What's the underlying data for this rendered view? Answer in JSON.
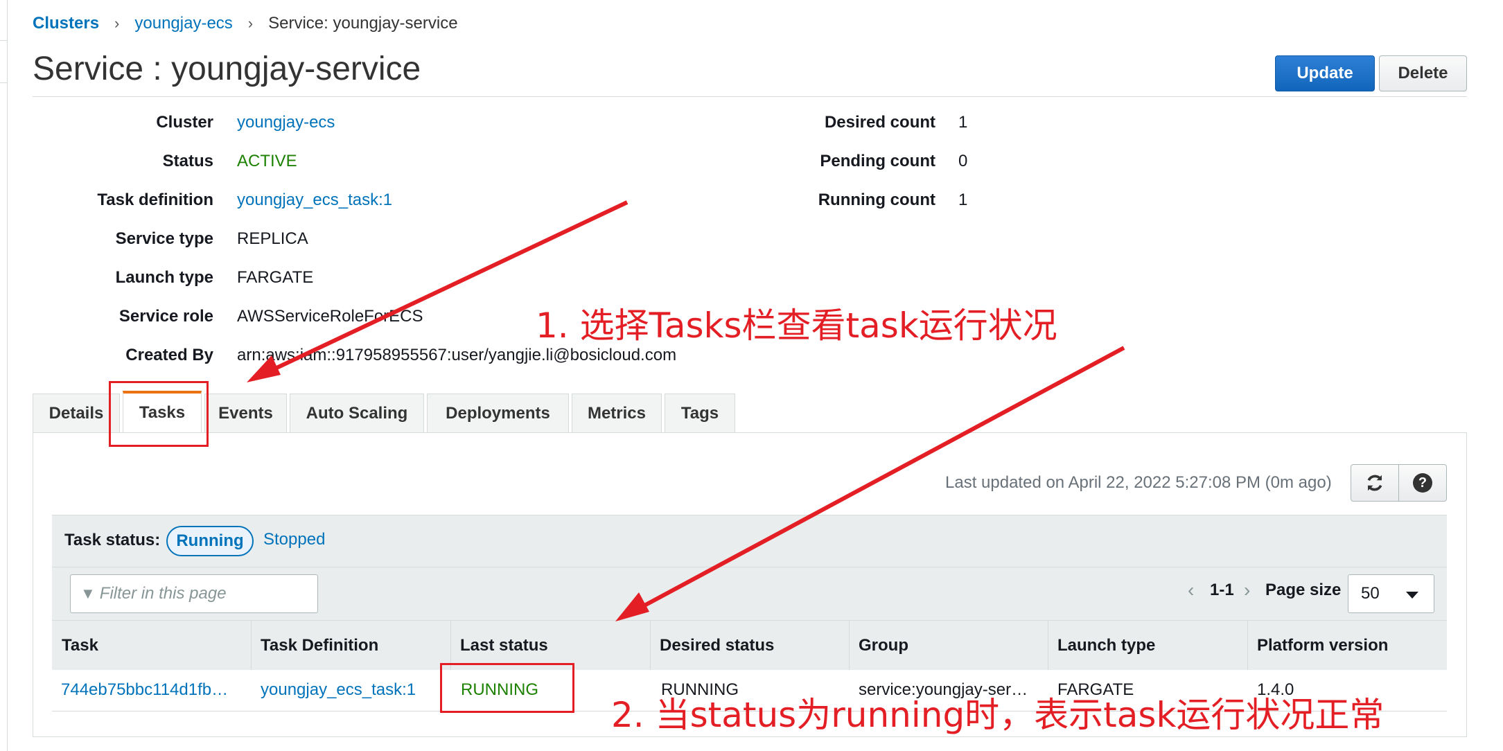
{
  "breadcrumb": {
    "clusters": "Clusters",
    "cluster": "youngjay-ecs",
    "current": "Service: youngjay-service",
    "separator": "›"
  },
  "page_title": "Service : youngjay-service",
  "actions": {
    "update": "Update",
    "delete": "Delete"
  },
  "details_left": [
    {
      "label": "Cluster",
      "value": "youngjay-ecs",
      "kind": "link"
    },
    {
      "label": "Status",
      "value": "ACTIVE",
      "kind": "active"
    },
    {
      "label": "Task definition",
      "value": "youngjay_ecs_task:1",
      "kind": "link"
    },
    {
      "label": "Service type",
      "value": "REPLICA",
      "kind": "text"
    },
    {
      "label": "Launch type",
      "value": "FARGATE",
      "kind": "text"
    },
    {
      "label": "Service role",
      "value": "AWSServiceRoleForECS",
      "kind": "text"
    },
    {
      "label": "Created By",
      "value": "arn:aws:iam::917958955567:user/yangjie.li@bosicloud.com",
      "kind": "text"
    }
  ],
  "details_right": [
    {
      "label": "Desired count",
      "value": "1"
    },
    {
      "label": "Pending count",
      "value": "0"
    },
    {
      "label": "Running count",
      "value": "1"
    }
  ],
  "tabs": [
    "Details",
    "Tasks",
    "Events",
    "Auto Scaling",
    "Deployments",
    "Metrics",
    "Tags"
  ],
  "selected_tab": "Tasks",
  "last_updated": "Last updated on April 22, 2022 5:27:08 PM (0m ago)",
  "task_status": {
    "label": "Task status:",
    "running": "Running",
    "stopped": "Stopped"
  },
  "filter": {
    "placeholder": "Filter in this page",
    "icon": "filter-icon"
  },
  "pagination": {
    "range": "1-1",
    "page_size_label": "Page size",
    "page_size": "50"
  },
  "table": {
    "columns": [
      "Task",
      "Task Definition",
      "Last status",
      "Desired status",
      "Group",
      "Launch type",
      "Platform version"
    ],
    "rows": [
      [
        "744eb75bbc114d1fb…",
        "youngjay_ecs_task:1",
        "RUNNING",
        "RUNNING",
        "service:youngjay-ser…",
        "FARGATE",
        "1.4.0"
      ]
    ]
  },
  "annotations": {
    "note1": "1. 选择Tasks栏查看task运行状况",
    "note2": "2. 当status为running时，表示task运行状况正常"
  },
  "colors": {
    "accent": "#0073bb",
    "active": "#1d8102",
    "tab_highlight": "#ec7211",
    "annotation": "#e31e24"
  }
}
